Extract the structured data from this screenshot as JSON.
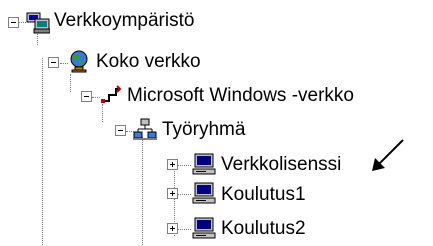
{
  "tree": {
    "nodes": [
      {
        "label": "Verkkoympäristö",
        "icon": "network-computers-icon",
        "state": "expanded"
      },
      {
        "label": "Koko verkko",
        "icon": "globe-icon",
        "state": "expanded"
      },
      {
        "label": "Microsoft Windows -verkko",
        "icon": "network-connection-icon",
        "state": "expanded"
      },
      {
        "label": "Työryhmä",
        "icon": "workgroup-icon",
        "state": "expanded"
      },
      {
        "label": "Verkkolisenssi",
        "icon": "computer-icon",
        "state": "collapsed"
      },
      {
        "label": "Koulutus1",
        "icon": "computer-icon",
        "state": "collapsed"
      },
      {
        "label": "Koulutus2",
        "icon": "computer-icon",
        "state": "collapsed"
      }
    ]
  },
  "annotation": {
    "icon": "arrow-icon"
  }
}
